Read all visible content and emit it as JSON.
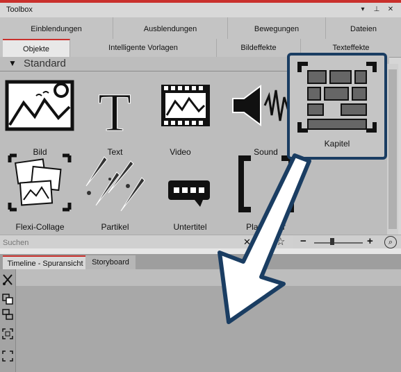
{
  "window": {
    "title": "Toolbox",
    "buttons": [
      "▾",
      "⊥",
      "✕"
    ]
  },
  "tabs_row1": [
    "Einblendungen",
    "Ausblendungen",
    "Bewegungen",
    "Dateien"
  ],
  "tabs_row2": [
    "Objekte",
    "Intelligente Vorlagen",
    "Bildeffekte",
    "Texteffekte"
  ],
  "section": {
    "label": "Standard"
  },
  "items": [
    "Bild",
    "Text",
    "Video",
    "Sound",
    "Kapitel",
    "Flexi-Collage",
    "Partikel",
    "Untertitel",
    "Platzhalter"
  ],
  "search": {
    "placeholder": "Suchen"
  },
  "timeline_tabs": [
    "Timeline - Spuransicht",
    "Storyboard"
  ],
  "colors": {
    "accent_red": "#c9302c",
    "callout_blue": "#1a3d62"
  }
}
